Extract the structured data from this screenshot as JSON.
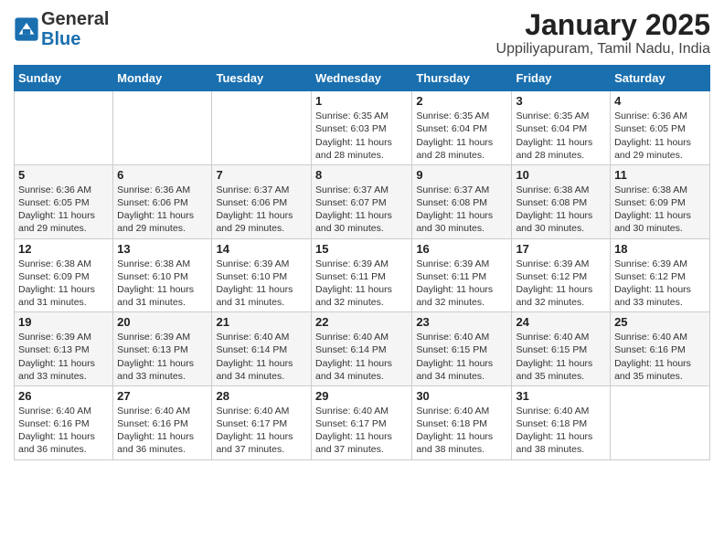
{
  "logo": {
    "general": "General",
    "blue": "Blue"
  },
  "title": "January 2025",
  "subtitle": "Uppiliyapuram, Tamil Nadu, India",
  "weekdays": [
    "Sunday",
    "Monday",
    "Tuesday",
    "Wednesday",
    "Thursday",
    "Friday",
    "Saturday"
  ],
  "weeks": [
    [
      {
        "day": "",
        "info": ""
      },
      {
        "day": "",
        "info": ""
      },
      {
        "day": "",
        "info": ""
      },
      {
        "day": "1",
        "info": "Sunrise: 6:35 AM\nSunset: 6:03 PM\nDaylight: 11 hours and 28 minutes."
      },
      {
        "day": "2",
        "info": "Sunrise: 6:35 AM\nSunset: 6:04 PM\nDaylight: 11 hours and 28 minutes."
      },
      {
        "day": "3",
        "info": "Sunrise: 6:35 AM\nSunset: 6:04 PM\nDaylight: 11 hours and 28 minutes."
      },
      {
        "day": "4",
        "info": "Sunrise: 6:36 AM\nSunset: 6:05 PM\nDaylight: 11 hours and 29 minutes."
      }
    ],
    [
      {
        "day": "5",
        "info": "Sunrise: 6:36 AM\nSunset: 6:05 PM\nDaylight: 11 hours and 29 minutes."
      },
      {
        "day": "6",
        "info": "Sunrise: 6:36 AM\nSunset: 6:06 PM\nDaylight: 11 hours and 29 minutes."
      },
      {
        "day": "7",
        "info": "Sunrise: 6:37 AM\nSunset: 6:06 PM\nDaylight: 11 hours and 29 minutes."
      },
      {
        "day": "8",
        "info": "Sunrise: 6:37 AM\nSunset: 6:07 PM\nDaylight: 11 hours and 30 minutes."
      },
      {
        "day": "9",
        "info": "Sunrise: 6:37 AM\nSunset: 6:08 PM\nDaylight: 11 hours and 30 minutes."
      },
      {
        "day": "10",
        "info": "Sunrise: 6:38 AM\nSunset: 6:08 PM\nDaylight: 11 hours and 30 minutes."
      },
      {
        "day": "11",
        "info": "Sunrise: 6:38 AM\nSunset: 6:09 PM\nDaylight: 11 hours and 30 minutes."
      }
    ],
    [
      {
        "day": "12",
        "info": "Sunrise: 6:38 AM\nSunset: 6:09 PM\nDaylight: 11 hours and 31 minutes."
      },
      {
        "day": "13",
        "info": "Sunrise: 6:38 AM\nSunset: 6:10 PM\nDaylight: 11 hours and 31 minutes."
      },
      {
        "day": "14",
        "info": "Sunrise: 6:39 AM\nSunset: 6:10 PM\nDaylight: 11 hours and 31 minutes."
      },
      {
        "day": "15",
        "info": "Sunrise: 6:39 AM\nSunset: 6:11 PM\nDaylight: 11 hours and 32 minutes."
      },
      {
        "day": "16",
        "info": "Sunrise: 6:39 AM\nSunset: 6:11 PM\nDaylight: 11 hours and 32 minutes."
      },
      {
        "day": "17",
        "info": "Sunrise: 6:39 AM\nSunset: 6:12 PM\nDaylight: 11 hours and 32 minutes."
      },
      {
        "day": "18",
        "info": "Sunrise: 6:39 AM\nSunset: 6:12 PM\nDaylight: 11 hours and 33 minutes."
      }
    ],
    [
      {
        "day": "19",
        "info": "Sunrise: 6:39 AM\nSunset: 6:13 PM\nDaylight: 11 hours and 33 minutes."
      },
      {
        "day": "20",
        "info": "Sunrise: 6:39 AM\nSunset: 6:13 PM\nDaylight: 11 hours and 33 minutes."
      },
      {
        "day": "21",
        "info": "Sunrise: 6:40 AM\nSunset: 6:14 PM\nDaylight: 11 hours and 34 minutes."
      },
      {
        "day": "22",
        "info": "Sunrise: 6:40 AM\nSunset: 6:14 PM\nDaylight: 11 hours and 34 minutes."
      },
      {
        "day": "23",
        "info": "Sunrise: 6:40 AM\nSunset: 6:15 PM\nDaylight: 11 hours and 34 minutes."
      },
      {
        "day": "24",
        "info": "Sunrise: 6:40 AM\nSunset: 6:15 PM\nDaylight: 11 hours and 35 minutes."
      },
      {
        "day": "25",
        "info": "Sunrise: 6:40 AM\nSunset: 6:16 PM\nDaylight: 11 hours and 35 minutes."
      }
    ],
    [
      {
        "day": "26",
        "info": "Sunrise: 6:40 AM\nSunset: 6:16 PM\nDaylight: 11 hours and 36 minutes."
      },
      {
        "day": "27",
        "info": "Sunrise: 6:40 AM\nSunset: 6:16 PM\nDaylight: 11 hours and 36 minutes."
      },
      {
        "day": "28",
        "info": "Sunrise: 6:40 AM\nSunset: 6:17 PM\nDaylight: 11 hours and 37 minutes."
      },
      {
        "day": "29",
        "info": "Sunrise: 6:40 AM\nSunset: 6:17 PM\nDaylight: 11 hours and 37 minutes."
      },
      {
        "day": "30",
        "info": "Sunrise: 6:40 AM\nSunset: 6:18 PM\nDaylight: 11 hours and 38 minutes."
      },
      {
        "day": "31",
        "info": "Sunrise: 6:40 AM\nSunset: 6:18 PM\nDaylight: 11 hours and 38 minutes."
      },
      {
        "day": "",
        "info": ""
      }
    ]
  ]
}
